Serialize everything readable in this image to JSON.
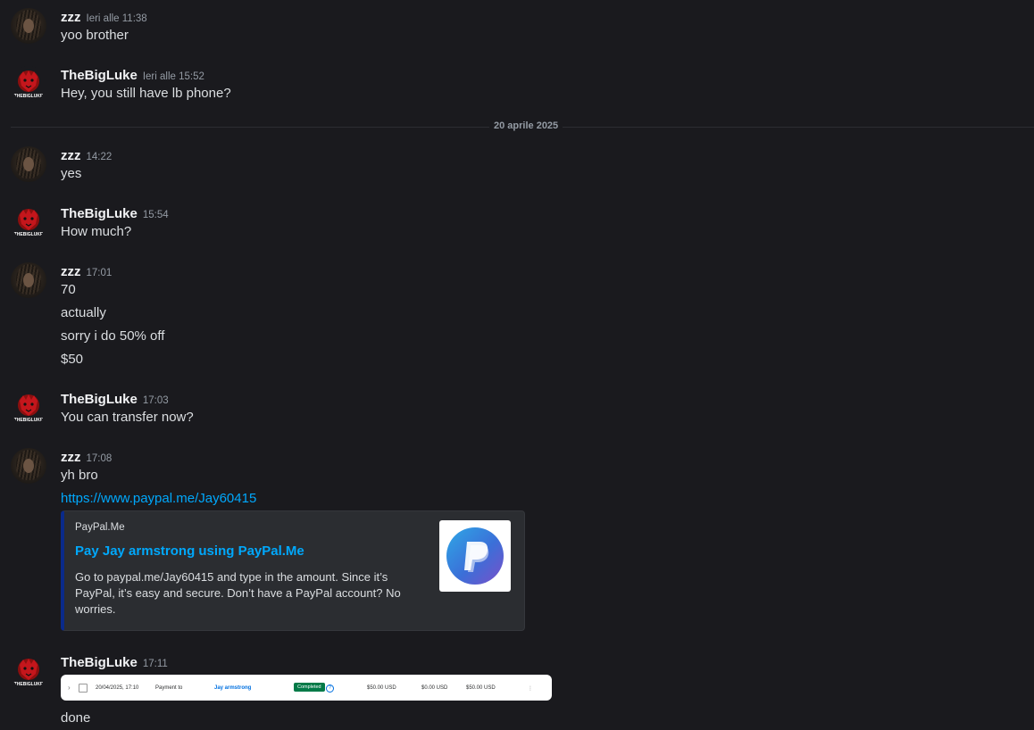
{
  "users": {
    "zzz": {
      "name": "zzz"
    },
    "luke": {
      "name": "TheBigLuke",
      "avatar_text": "THEBIGLUKE"
    }
  },
  "divider": {
    "label": "20 aprile 2025"
  },
  "messages": [
    {
      "author": "zzz",
      "time": "Ieri alle 11:38",
      "lines": [
        "yoo brother"
      ]
    },
    {
      "author": "TheBigLuke",
      "time": "Ieri alle 15:52",
      "lines": [
        "Hey, you still have lb phone?"
      ]
    },
    {
      "author": "zzz",
      "time": "14:22",
      "lines": [
        "yes"
      ]
    },
    {
      "author": "TheBigLuke",
      "time": "15:54",
      "lines": [
        "How much?"
      ]
    },
    {
      "author": "zzz",
      "time": "17:01",
      "lines": [
        "70",
        "actually",
        "sorry i do 50% off",
        "$50"
      ]
    },
    {
      "author": "TheBigLuke",
      "time": "17:03",
      "lines": [
        "You can transfer now?"
      ]
    },
    {
      "author": "zzz",
      "time": "17:08",
      "lines": [
        "yh bro"
      ],
      "link": "https://www.paypal.me/Jay60415"
    },
    {
      "author": "TheBigLuke",
      "time": "17:11",
      "lines": [
        "done"
      ]
    }
  ],
  "embed": {
    "provider": "PayPal.Me",
    "title": "Pay Jay armstrong using PayPal.Me",
    "description": "Go to paypal.me/Jay60415 and type in the amount. Since it’s PayPal, it’s easy and secure. Don’t have a PayPal account? No worries.",
    "thumb_icon": "paypal-logo-icon"
  },
  "attachment": {
    "date": "20/04/2025, 17:10",
    "type": "Payment to",
    "recipient": "Jay armstrong",
    "status": "Completed",
    "gross": "$50.00 USD",
    "fee": "$0.00 USD",
    "net": "$50.00 USD",
    "menu": "⋮"
  },
  "colors": {
    "background": "#1a1a1e",
    "link": "#00a8fc",
    "text": "#dbdee1",
    "timestamp": "#949ba4",
    "completed_badge": "#027a48"
  }
}
